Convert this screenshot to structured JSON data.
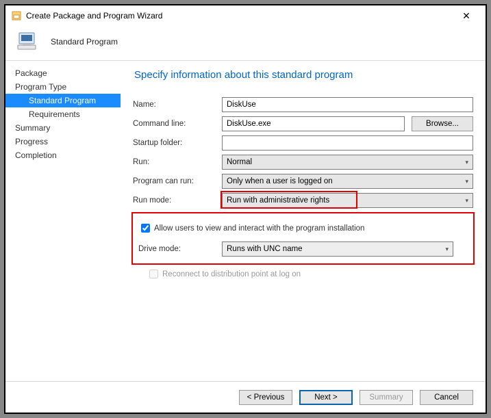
{
  "window": {
    "title": "Create Package and Program Wizard"
  },
  "banner": {
    "subtitle": "Standard Program"
  },
  "sidebar": {
    "items": [
      {
        "label": "Package",
        "level": 1
      },
      {
        "label": "Program Type",
        "level": 1
      },
      {
        "label": "Standard Program",
        "level": 2,
        "selected": true
      },
      {
        "label": "Requirements",
        "level": 2
      },
      {
        "label": "Summary",
        "level": 1
      },
      {
        "label": "Progress",
        "level": 1
      },
      {
        "label": "Completion",
        "level": 1
      }
    ]
  },
  "page": {
    "heading": "Specify information about this standard program",
    "labels": {
      "name": "Name:",
      "command": "Command line:",
      "startup": "Startup folder:",
      "run": "Run:",
      "canrun": "Program can run:",
      "runmode": "Run mode:",
      "drivemode": "Drive mode:"
    },
    "fields": {
      "name": "DiskUse",
      "command": "DiskUse.exe",
      "startup": "",
      "run": "Normal",
      "canrun": "Only when a user is logged on",
      "runmode": "Run with administrative rights",
      "drivemode": "Runs with UNC name"
    },
    "browse": "Browse...",
    "allow_users_label": "Allow users to view and interact with the program installation",
    "allow_users_checked": true,
    "reconnect_label": "Reconnect to distribution point at log on",
    "reconnect_enabled": false
  },
  "footer": {
    "previous": "< Previous",
    "next": "Next >",
    "summary": "Summary",
    "cancel": "Cancel"
  }
}
